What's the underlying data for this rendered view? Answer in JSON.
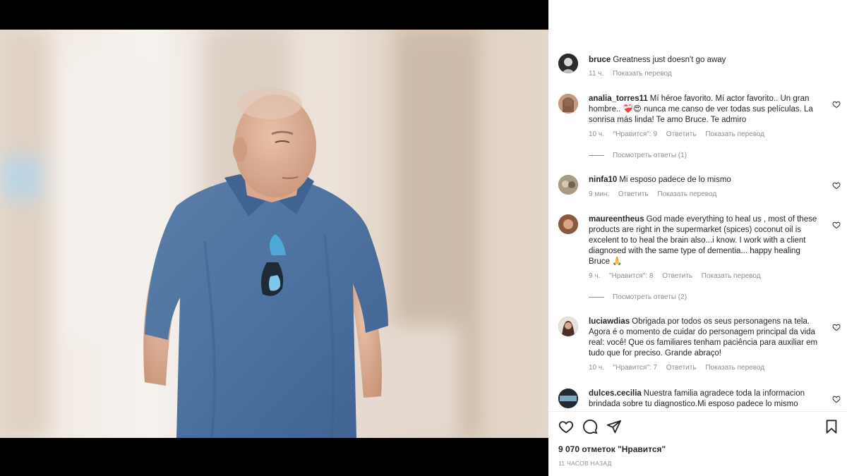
{
  "post": {
    "author": "bruce",
    "caption": "Greatness just doesn't go away",
    "time": "11 ч.",
    "translate": "Показать перевод"
  },
  "comments": [
    {
      "user": "analia_torres11",
      "text": "Mí héroe favorito. Mí actor favorito.. Un gran hombre.. ❤️‍🩹😍 nunca me canso de ver todas sus películas. La sonrisa más linda! Te amo Bruce. Te admiro",
      "time": "10 ч.",
      "likes": "\"Нравится\": 9",
      "reply": "Ответить",
      "translate": "Показать перевод",
      "replies": "Посмотреть ответы (1)"
    },
    {
      "user": "ninfa10",
      "text": "Mi esposo padece de lo mismo",
      "time": "9 мин.",
      "reply": "Ответить",
      "translate": "Показать перевод"
    },
    {
      "user": "maureentheus",
      "text": "God made everything to heal us , most of these products are right in the supermarket (spices) coconut oil is excelent to to heal the brain also...i know. I work with a client diagnosed with the same type of dementia... happy healing Bruce 🙏",
      "time": "9 ч.",
      "likes": "\"Нравится\": 8",
      "reply": "Ответить",
      "translate": "Показать перевод",
      "replies": "Посмотреть ответы (2)"
    },
    {
      "user": "luciawdias",
      "text": "Obrigada por todos os seus personagens na tela. Agora é o momento de cuidar do personagem principal da vida real: você! Que os familiares tenham paciência para auxiliar em tudo que for preciso. Grande abraço!",
      "time": "10 ч.",
      "likes": "\"Нравится\": 7",
      "reply": "Ответить",
      "translate": "Показать перевод"
    },
    {
      "user": "dulces.cecilia",
      "text": "Nuestra familia agradece toda la informacion brindada sobre tu diagnostico.Mi esposo padece lo mismo"
    }
  ],
  "footer": {
    "likes": "9 070 отметок \"Нравится\"",
    "time": "11 ЧАСОВ НАЗАД"
  },
  "icons": [
    "heart-icon",
    "comment-icon",
    "share-icon",
    "bookmark-icon"
  ]
}
